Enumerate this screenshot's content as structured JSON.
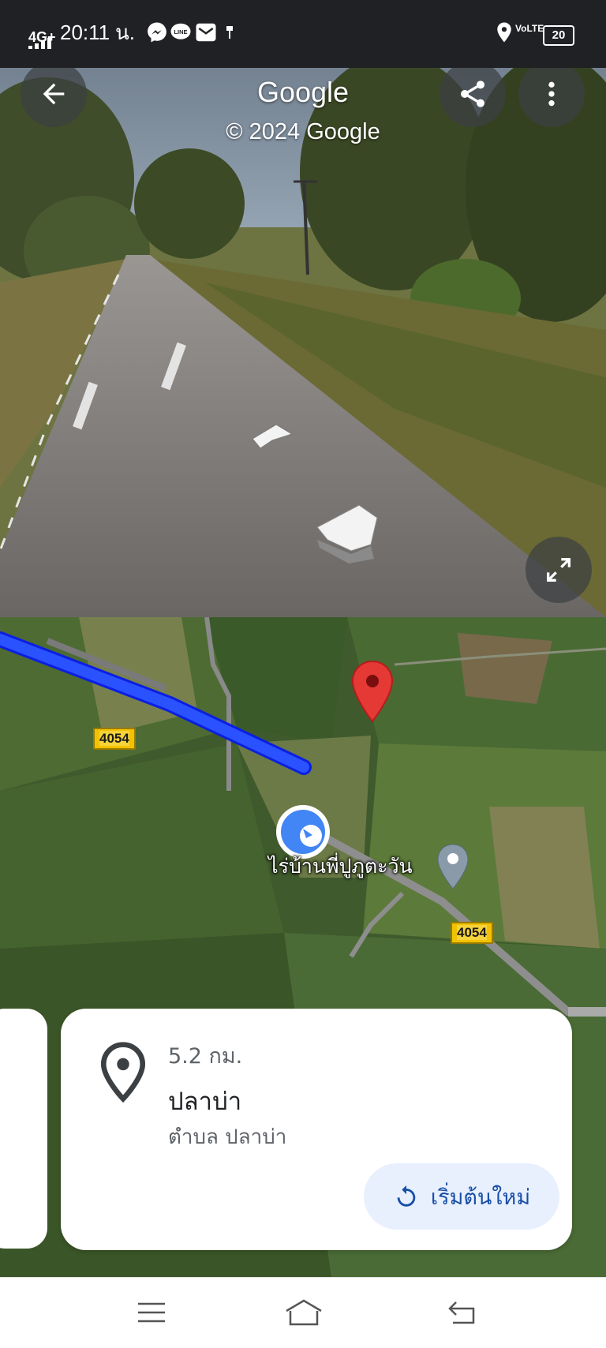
{
  "status_bar": {
    "network": "4G+",
    "time": "20:11",
    "time_suffix": "น.",
    "volte": "VoLTE",
    "battery": "20"
  },
  "street_view": {
    "brand": "Google",
    "copyright": "© 2024 Google",
    "back_icon": "arrow-left-icon",
    "share_icon": "share-icon",
    "more_icon": "more-vert-icon",
    "expand_icon": "expand-icon"
  },
  "map": {
    "route_shield_1": "4054",
    "route_shield_2": "4054",
    "poi_label": "ไร่บ้านพี่ปูภูตะวัน"
  },
  "place_card": {
    "distance": "5.2 กม.",
    "title": "ปลาบ่า",
    "subtitle": "ตำบล ปลาบ่า",
    "restart_label": "เริ่มต้นใหม่"
  },
  "colors": {
    "route": "#1a47ff",
    "pin": "#e53935",
    "accent": "#174ea6"
  }
}
